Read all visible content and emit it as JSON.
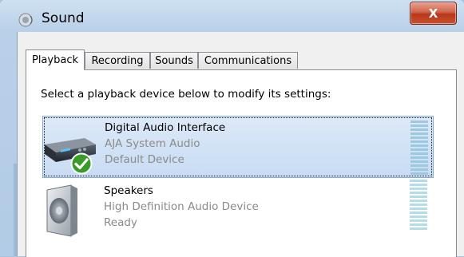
{
  "window": {
    "title": "Sound",
    "close_label": "X"
  },
  "tabs": [
    {
      "label": "Playback",
      "active": true
    },
    {
      "label": "Recording",
      "active": false
    },
    {
      "label": "Sounds",
      "active": false
    },
    {
      "label": "Communications",
      "active": false
    }
  ],
  "playback": {
    "instruction": "Select a playback device below to modify its settings:",
    "devices": [
      {
        "name": "Digital Audio Interface",
        "line2": "AJA System Audio",
        "line3": "Default Device",
        "selected": true,
        "icon": "digital-audio-interface-icon",
        "status_icon": "default-device-check-icon"
      },
      {
        "name": "Speakers",
        "line2": "High Definition Audio Device",
        "line3": "Ready",
        "selected": false,
        "icon": "speaker-icon"
      }
    ]
  },
  "colors": {
    "selection": "#c7dcf4",
    "check_green": "#3a9b2a",
    "close_red": "#c9512f"
  }
}
